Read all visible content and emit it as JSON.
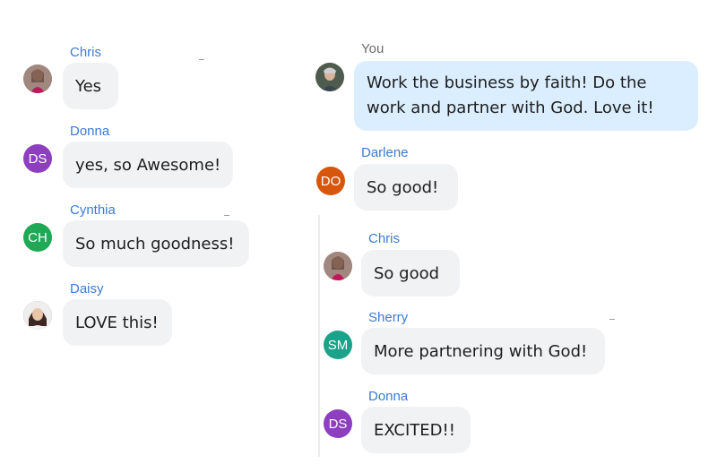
{
  "colors": {
    "name": "#3a7bd5",
    "self_name": "#6b6b6b",
    "bubble": "#f1f2f4",
    "self_bubble": "#dbeeff",
    "ds": "#8e3fbf",
    "ch": "#1fa855",
    "do": "#d8560b",
    "sm": "#1aa38a"
  },
  "left": [
    {
      "sender": "Chris",
      "avatar": {
        "type": "photo",
        "icon": "chris-photo-icon"
      },
      "text": "Yes"
    },
    {
      "sender": "Donna",
      "avatar": {
        "type": "initials",
        "initials": "DS"
      },
      "text": "yes, so Awesome!"
    },
    {
      "sender": "Cynthia",
      "avatar": {
        "type": "initials",
        "initials": "CH"
      },
      "text": "So much goodness!"
    },
    {
      "sender": "Daisy",
      "avatar": {
        "type": "photo",
        "icon": "daisy-photo-icon"
      },
      "text": "LOVE this!"
    }
  ],
  "right": [
    {
      "sender": "You",
      "avatar": {
        "type": "photo",
        "icon": "you-photo-icon"
      },
      "text": "Work the business by faith! Do the work and partner with God. Love it!"
    },
    {
      "sender": "Darlene",
      "avatar": {
        "type": "initials",
        "initials": "DO"
      },
      "text": "So good!"
    },
    {
      "sender": "Chris",
      "avatar": {
        "type": "photo",
        "icon": "chris-photo-icon"
      },
      "text": "So good"
    },
    {
      "sender": "Sherry",
      "avatar": {
        "type": "initials",
        "initials": "SM"
      },
      "text": "More partnering with God!"
    },
    {
      "sender": "Donna",
      "avatar": {
        "type": "initials",
        "initials": "DS"
      },
      "text": "EXCITED!!"
    }
  ]
}
